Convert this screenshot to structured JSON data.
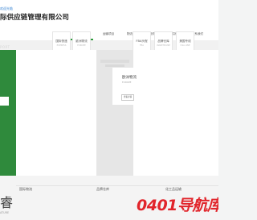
{
  "header": {
    "tagline": "欢迎光临",
    "company_name": "际供应链管理有限公司"
  },
  "nav": {
    "items": [
      {
        "label": "网站首页",
        "active": true
      },
      {
        "label": "运输项目",
        "active": false
      },
      {
        "label": "物流专线",
        "active": false
      },
      {
        "label": "物流资讯",
        "active": false
      },
      {
        "label": "成功案例",
        "active": false
      },
      {
        "label": "联系我们",
        "active": false
      }
    ]
  },
  "hero": {
    "ghost_text": "PORT"
  },
  "services": [
    {
      "title": "国际快递",
      "sub": "EXPRESS"
    },
    {
      "title": "欧洲物流",
      "sub": "EUROPE"
    },
    {
      "title": "FBA头程",
      "sub": "FBA"
    },
    {
      "title": "品牌仓库",
      "sub": "WAREHOUSE"
    },
    {
      "title": "美国专线",
      "sub": "USA LINE"
    }
  ],
  "news": {
    "title": "欧洲物流",
    "sub": "EUROPE",
    "button": "查看详情"
  },
  "lower": {
    "items": [
      "国际物流",
      "品牌仓库",
      "化工品运输"
    ]
  },
  "bottom": {
    "glyph": "睿",
    "sub": "ATURE"
  },
  "watermark": {
    "text": "0401导航库"
  },
  "colors": {
    "accent": "#2b9a3a",
    "green_panel": "#2f8a3c",
    "watermark": "#e1252b",
    "tagline": "#2f7fd1"
  }
}
